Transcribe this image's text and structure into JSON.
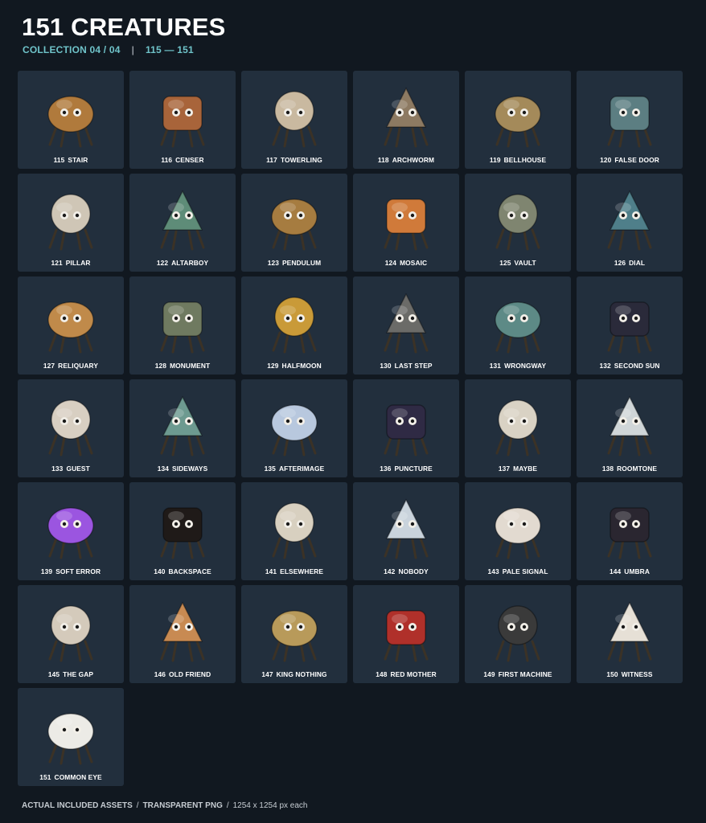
{
  "header": {
    "title": "151 CREATURES",
    "collection": "COLLECTION 04 / 04",
    "divider": "|",
    "range": "115 — 151"
  },
  "creatures": [
    {
      "num": "115",
      "name": "STAIR",
      "icon": "stair-creature-icon",
      "color": "#b07a3c"
    },
    {
      "num": "116",
      "name": "CENSER",
      "icon": "censer-creature-icon",
      "color": "#a8643a"
    },
    {
      "num": "117",
      "name": "TOWERLING",
      "icon": "towerling-creature-icon",
      "color": "#c9b9a0"
    },
    {
      "num": "118",
      "name": "ARCHWORM",
      "icon": "archworm-creature-icon",
      "color": "#8d7a62"
    },
    {
      "num": "119",
      "name": "BELLHOUSE",
      "icon": "bellhouse-creature-icon",
      "color": "#a48a5a"
    },
    {
      "num": "120",
      "name": "FALSE DOOR",
      "icon": "false-door-creature-icon",
      "color": "#5c7e82"
    },
    {
      "num": "121",
      "name": "PILLAR",
      "icon": "pillar-creature-icon",
      "color": "#cfc6b6"
    },
    {
      "num": "122",
      "name": "ALTARBOY",
      "icon": "altarboy-creature-icon",
      "color": "#5e8c78"
    },
    {
      "num": "123",
      "name": "PENDULUM",
      "icon": "pendulum-creature-icon",
      "color": "#a67c40"
    },
    {
      "num": "124",
      "name": "MOSAIC",
      "icon": "mosaic-creature-icon",
      "color": "#d07a3a"
    },
    {
      "num": "125",
      "name": "VAULT",
      "icon": "vault-creature-icon",
      "color": "#7f8570"
    },
    {
      "num": "126",
      "name": "DIAL",
      "icon": "dial-creature-icon",
      "color": "#4f7f8a"
    },
    {
      "num": "127",
      "name": "RELIQUARY",
      "icon": "reliquary-creature-icon",
      "color": "#c08a4a"
    },
    {
      "num": "128",
      "name": "MONUMENT",
      "icon": "monument-creature-icon",
      "color": "#6f7a60"
    },
    {
      "num": "129",
      "name": "HALFMOON",
      "icon": "halfmoon-creature-icon",
      "color": "#c99a38"
    },
    {
      "num": "130",
      "name": "LAST STEP",
      "icon": "last-step-creature-icon",
      "color": "#6b6b68"
    },
    {
      "num": "131",
      "name": "WRONGWAY",
      "icon": "wrongway-creature-icon",
      "color": "#5d8a86"
    },
    {
      "num": "132",
      "name": "SECOND SUN",
      "icon": "second-sun-creature-icon",
      "color": "#2a2a3a"
    },
    {
      "num": "133",
      "name": "GUEST",
      "icon": "guest-creature-icon",
      "color": "#d8cfc2"
    },
    {
      "num": "134",
      "name": "SIDEWAYS",
      "icon": "sideways-creature-icon",
      "color": "#6d9a90"
    },
    {
      "num": "135",
      "name": "AFTERIMAGE",
      "icon": "afterimage-creature-icon",
      "color": "#b8c8de"
    },
    {
      "num": "136",
      "name": "PUNCTURE",
      "icon": "puncture-creature-icon",
      "color": "#2f2a44"
    },
    {
      "num": "137",
      "name": "MAYBE",
      "icon": "maybe-creature-icon",
      "color": "#d9d2c4"
    },
    {
      "num": "138",
      "name": "ROOMTONE",
      "icon": "roomtone-creature-icon",
      "color": "#d0d6d8"
    },
    {
      "num": "139",
      "name": "SOFT ERROR",
      "icon": "soft-error-creature-icon",
      "color": "#9b55e0"
    },
    {
      "num": "140",
      "name": "BACKSPACE",
      "icon": "backspace-creature-icon",
      "color": "#1f1a18"
    },
    {
      "num": "141",
      "name": "ELSEWHERE",
      "icon": "elsewhere-creature-icon",
      "color": "#d8d0c0"
    },
    {
      "num": "142",
      "name": "NOBODY",
      "icon": "nobody-creature-icon",
      "color": "#c9d3dc"
    },
    {
      "num": "143",
      "name": "PALE SIGNAL",
      "icon": "pale-signal-creature-icon",
      "color": "#e2dad0"
    },
    {
      "num": "144",
      "name": "UMBRA",
      "icon": "umbra-creature-icon",
      "color": "#2a2630"
    },
    {
      "num": "145",
      "name": "THE GAP",
      "icon": "the-gap-creature-icon",
      "color": "#d4cabb"
    },
    {
      "num": "146",
      "name": "OLD FRIEND",
      "icon": "old-friend-creature-icon",
      "color": "#c88a52"
    },
    {
      "num": "147",
      "name": "KING NOTHING",
      "icon": "king-nothing-creature-icon",
      "color": "#b89a5a"
    },
    {
      "num": "148",
      "name": "RED MOTHER",
      "icon": "red-mother-creature-icon",
      "color": "#b0302a"
    },
    {
      "num": "149",
      "name": "FIRST MACHINE",
      "icon": "first-machine-creature-icon",
      "color": "#3a3a3a"
    },
    {
      "num": "150",
      "name": "WITNESS",
      "icon": "witness-creature-icon",
      "color": "#e6e0d6"
    },
    {
      "num": "151",
      "name": "COMMON EYE",
      "icon": "common-eye-creature-icon",
      "color": "#ecebe6"
    }
  ],
  "footer": {
    "assets": "ACTUAL INCLUDED ASSETS",
    "sep1": "/",
    "format": "TRANSPARENT PNG",
    "sep2": "/",
    "size": "1254 x 1254 px each"
  },
  "colors": {
    "background": "#111820",
    "card": "#222f3d",
    "accent": "#6fc3c9"
  }
}
